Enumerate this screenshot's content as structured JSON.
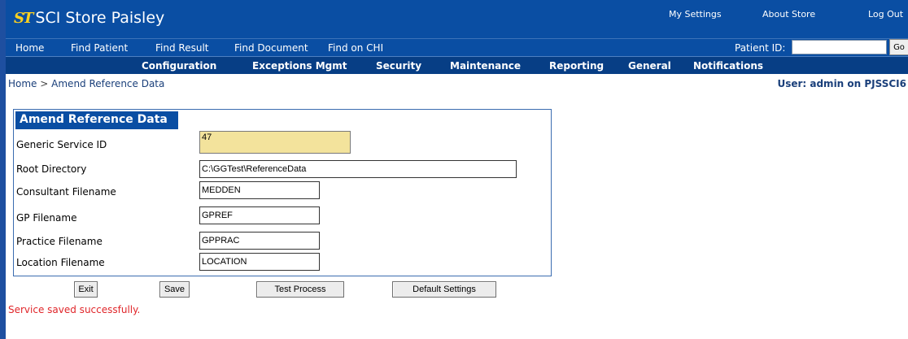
{
  "app": {
    "logo_mark": "ST",
    "title": "SCI Store Paisley"
  },
  "utility_links": [
    "My Settings",
    "About Store",
    "Log Out"
  ],
  "nav_primary": [
    "Home",
    "Find Patient",
    "Find Result",
    "Find Document",
    "Find on CHI"
  ],
  "patient_search": {
    "label": "Patient ID:",
    "value": "",
    "go_label": "Go"
  },
  "nav_secondary": [
    "Configuration",
    "Exceptions Mgmt",
    "Security",
    "Maintenance",
    "Reporting",
    "General",
    "Notifications"
  ],
  "breadcrumb": {
    "home": "Home",
    "separator": ">",
    "current": "Amend Reference Data"
  },
  "user_info": "User: admin on PJSSCI6",
  "form": {
    "title": "Amend Reference Data",
    "fields": [
      {
        "label": "Generic Service ID",
        "value": "47"
      },
      {
        "label": "Root Directory",
        "value": "C:\\GGTest\\ReferenceData"
      },
      {
        "label": "Consultant Filename",
        "value": "MEDDEN"
      },
      {
        "label": "GP Filename",
        "value": "GPREF"
      },
      {
        "label": "Practice Filename",
        "value": "GPPRAC"
      },
      {
        "label": "Location Filename",
        "value": "LOCATION"
      }
    ]
  },
  "buttons": {
    "exit": "Exit",
    "save": "Save",
    "test_process": "Test Process",
    "default_settings": "Default Settings"
  },
  "status_message": "Service saved successfully.",
  "colors": {
    "header_blue": "#0a4ea3",
    "menu_blue": "#073e85",
    "readonly_field": "#f3e39c",
    "status_red": "#e0262a",
    "logo_gold": "#ffd21f"
  }
}
